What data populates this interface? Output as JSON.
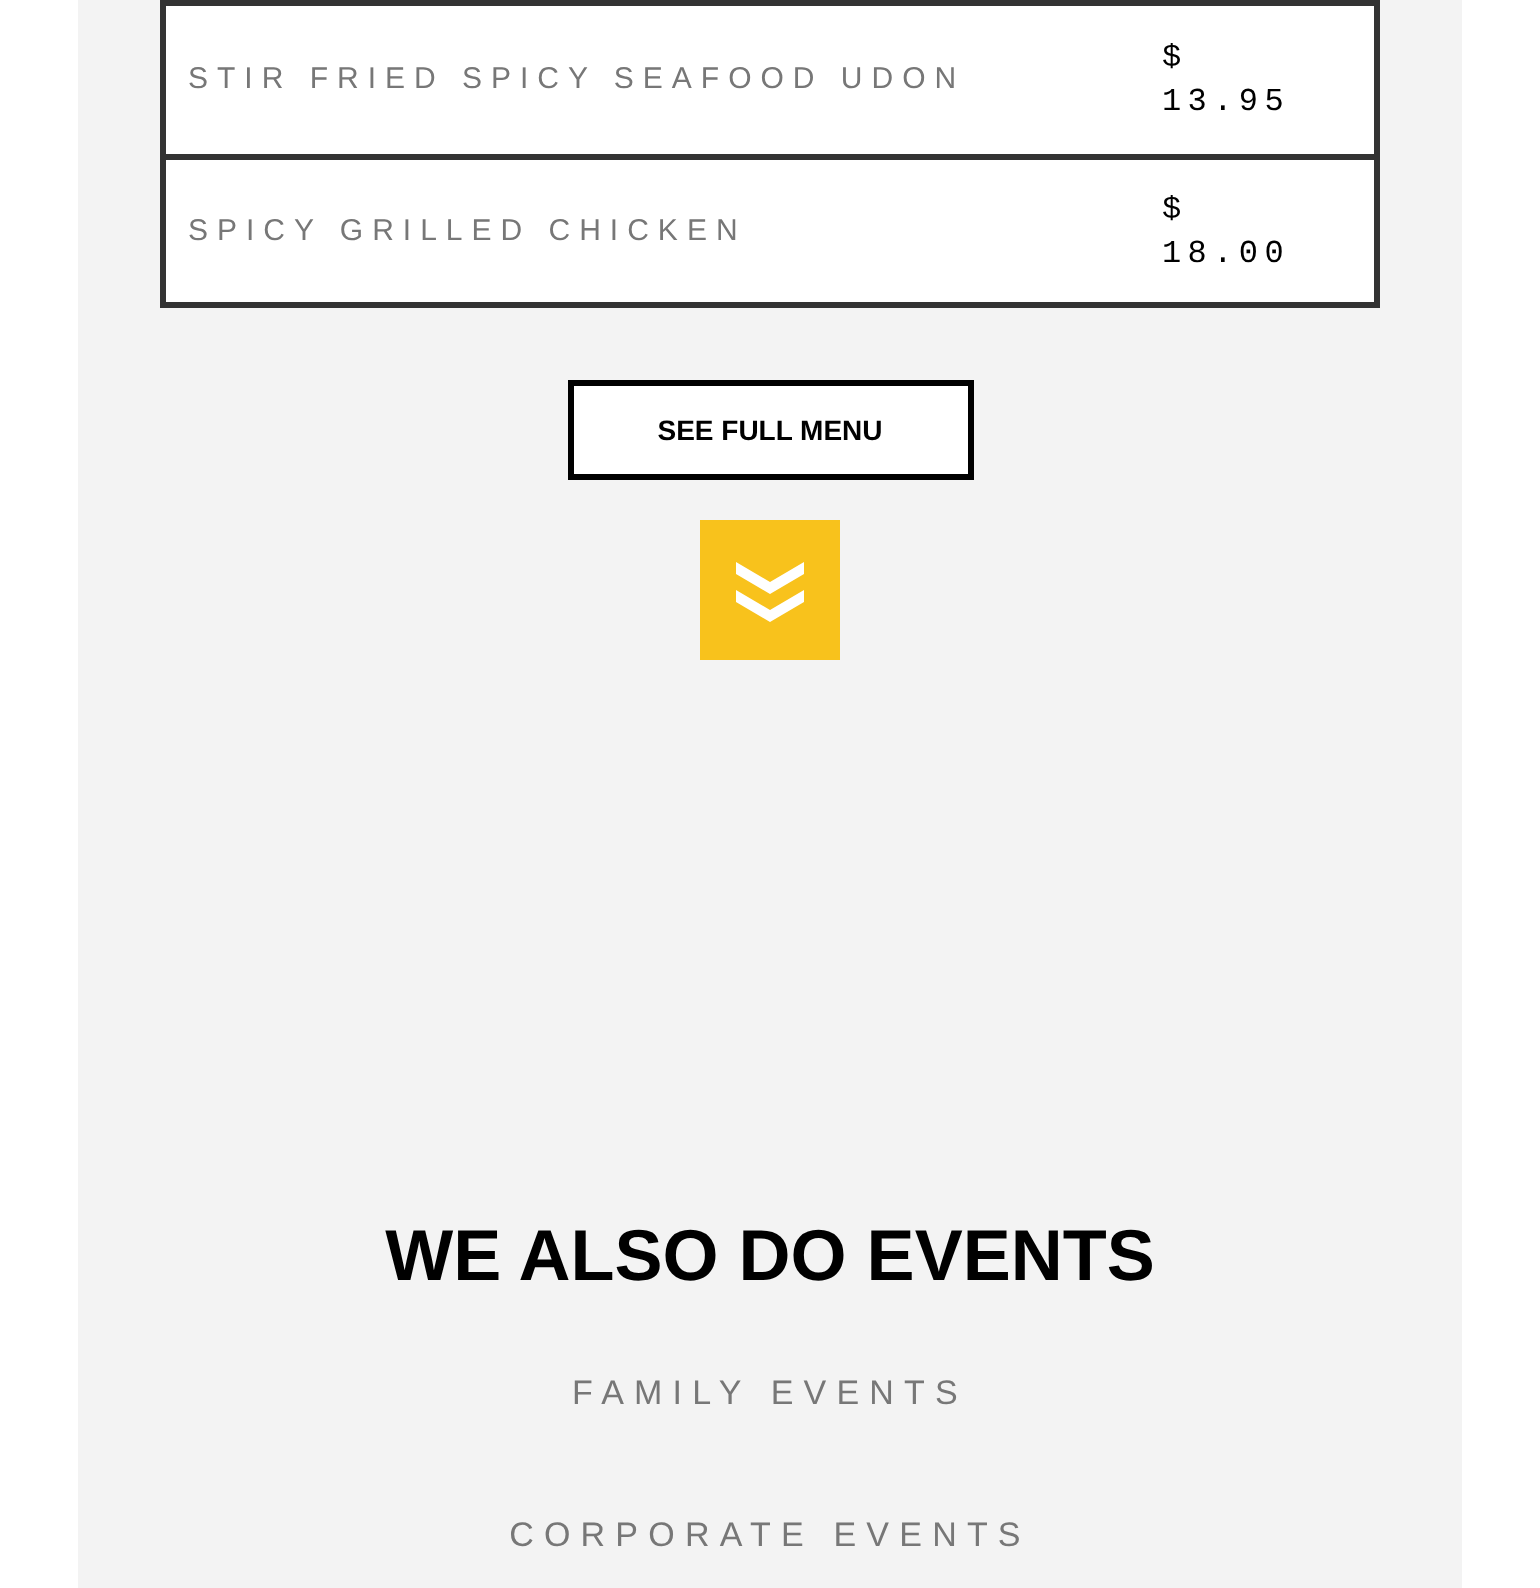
{
  "menu": {
    "rows": [
      {
        "name": "STIR FRIED SPICY SEAFOOD UDON",
        "price": "$ 13.95"
      },
      {
        "name": "SPICY GRILLED CHICKEN",
        "price": "$ 18.00"
      }
    ],
    "button": "SEE FULL MENU"
  },
  "events": {
    "title": "WE ALSO DO EVENTS",
    "items": [
      "FAMILY EVENTS",
      "CORPORATE EVENTS"
    ]
  }
}
